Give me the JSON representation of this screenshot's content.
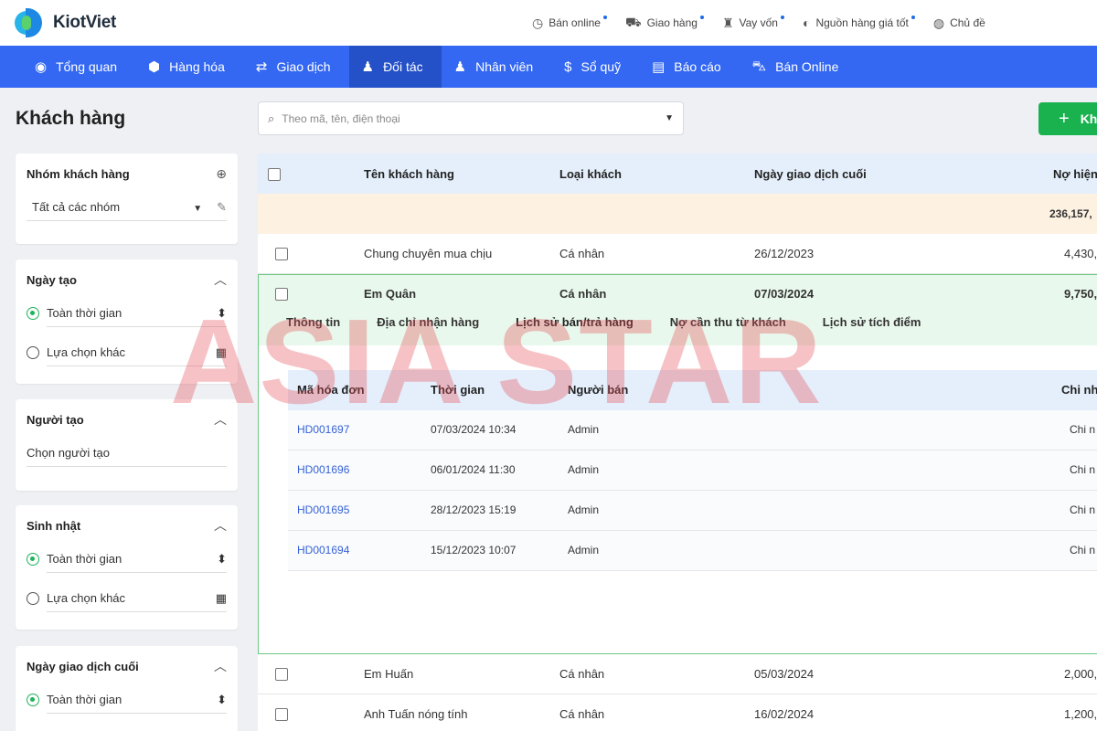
{
  "brand": {
    "name": "KiotViet"
  },
  "toplinks": [
    {
      "icon": "clock-icon",
      "glyph": "◷",
      "label": "Bán online"
    },
    {
      "icon": "truck-icon",
      "glyph": "⛟",
      "label": "Giao hàng"
    },
    {
      "icon": "money-bag-icon",
      "glyph": "♜",
      "label": "Vay vốn"
    },
    {
      "icon": "supplier-icon",
      "glyph": "◐",
      "label": "Nguồn hàng giá tốt"
    },
    {
      "icon": "palette-icon",
      "glyph": "◍",
      "label": "Chủ đề"
    }
  ],
  "nav": [
    {
      "icon": "eye-icon",
      "glyph": "◉",
      "label": "Tổng quan"
    },
    {
      "icon": "box-icon",
      "glyph": "⬢",
      "label": "Hàng hóa"
    },
    {
      "icon": "exchange-icon",
      "glyph": "⇄",
      "label": "Giao dịch"
    },
    {
      "icon": "user-icon",
      "glyph": "♟",
      "label": "Đối tác",
      "active": true
    },
    {
      "icon": "users-icon",
      "glyph": "♟",
      "label": "Nhân viên"
    },
    {
      "icon": "dollar-icon",
      "glyph": "$",
      "label": "Sổ quỹ"
    },
    {
      "icon": "report-icon",
      "glyph": "▤",
      "label": "Báo cáo"
    },
    {
      "icon": "cart-icon",
      "glyph": "⛍",
      "label": "Bán Online"
    }
  ],
  "page": {
    "title": "Khách hàng"
  },
  "filters": {
    "group": {
      "title": "Nhóm khách hàng",
      "value": "Tất cả các nhóm"
    },
    "created_date": {
      "title": "Ngày tạo",
      "all_time": "Toàn thời gian",
      "other": "Lựa chọn khác"
    },
    "creator": {
      "title": "Người tạo",
      "placeholder": "Chọn người tạo"
    },
    "birthday": {
      "title": "Sinh nhật",
      "all_time": "Toàn thời gian",
      "other": "Lựa chọn khác"
    },
    "last_trade": {
      "title": "Ngày giao dịch cuối",
      "all_time": "Toàn thời gian"
    }
  },
  "search": {
    "placeholder": "Theo mã, tên, điện thoại"
  },
  "add_button": {
    "label": "Kh"
  },
  "table": {
    "headers": {
      "name": "Tên khách hàng",
      "type": "Loại khách",
      "last_trade": "Ngày giao dịch cuối",
      "debt": "Nợ hiện"
    },
    "summary_debt": "236,157,",
    "rows_top": [
      {
        "name": "Chung chuyên mua chịu",
        "type": "Cá nhân",
        "date": "26/12/2023",
        "debt": "4,430,"
      }
    ],
    "expanded_row": {
      "name": "Em Quân",
      "type": "Cá nhân",
      "date": "07/03/2024",
      "debt": "9,750,"
    },
    "rows_bottom": [
      {
        "name": "Em Huấn",
        "type": "Cá nhân",
        "date": "05/03/2024",
        "debt": "2,000,"
      },
      {
        "name": "Anh Tuấn nóng tính",
        "type": "Cá nhân",
        "date": "16/02/2024",
        "debt": "1,200,"
      }
    ]
  },
  "detail": {
    "tabs": [
      "Thông tin",
      "Địa chỉ nhận hàng",
      "Lịch sử bán/trả hàng",
      "Nợ cần thu từ khách",
      "Lịch sử tích điểm"
    ],
    "headers": {
      "invoice": "Mã hóa đơn",
      "time": "Thời gian",
      "seller": "Người bán",
      "branch": "Chi nh"
    },
    "rows": [
      {
        "invoice": "HD001697",
        "time": "07/03/2024 10:34",
        "seller": "Admin",
        "branch": "Chi n"
      },
      {
        "invoice": "HD001696",
        "time": "06/01/2024 11:30",
        "seller": "Admin",
        "branch": "Chi n"
      },
      {
        "invoice": "HD001695",
        "time": "28/12/2023 15:19",
        "seller": "Admin",
        "branch": "Chi n"
      },
      {
        "invoice": "HD001694",
        "time": "15/12/2023 10:07",
        "seller": "Admin",
        "branch": "Chi n"
      }
    ]
  },
  "watermark": "ASIA STAR"
}
